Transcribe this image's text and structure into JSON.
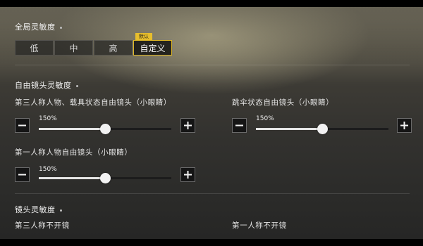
{
  "global_sensitivity": {
    "title": "全局灵敏度",
    "default_tag": "默认",
    "options": [
      "低",
      "中",
      "高",
      "自定义"
    ],
    "selected": "自定义"
  },
  "free_camera": {
    "title": "自由镜头灵敏度",
    "sliders": [
      {
        "label": "第三人称人物、载具状态自由镜头（小眼睛）",
        "value_text": "150%",
        "value_fraction": 0.5
      },
      {
        "label": "跳伞状态自由镜头（小眼睛）",
        "value_text": "150%",
        "value_fraction": 0.5
      },
      {
        "label": "第一人称人物自由镜头（小眼睛）",
        "value_text": "150%",
        "value_fraction": 0.5
      }
    ]
  },
  "camera_sensitivity": {
    "title": "镜头灵敏度",
    "items": [
      "第三人称不开镜",
      "第一人称不开镜"
    ]
  },
  "icons": {
    "decrease": "minus-icon",
    "increase": "plus-icon"
  },
  "colors": {
    "accent": "#e0b826",
    "track_fill": "#e4e4e4"
  }
}
